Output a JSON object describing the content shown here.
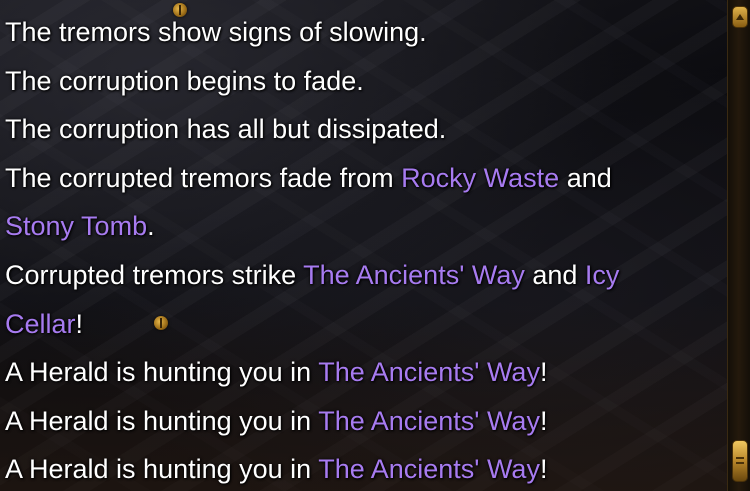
{
  "colors": {
    "text": "#ffffff",
    "location": "#a77bf0",
    "scroll_accent": "#c8962e"
  },
  "icons": {
    "map_marker": "gold-gem-marker-icon",
    "scroll_up": "scroll-up-arrow-icon",
    "scroll_thumb": "scroll-thumb-handle"
  },
  "log": {
    "lines": [
      {
        "text": "The tremors show signs of slowing."
      },
      {
        "text": "The corruption begins to fade."
      },
      {
        "text": "The corruption has all but dissipated."
      },
      {
        "pre": "The corrupted tremors fade from ",
        "loc1": "Rocky Waste",
        "mid": " and"
      },
      {
        "loc": "Stony Tomb",
        "post": "."
      },
      {
        "pre": "Corrupted tremors strike ",
        "loc1": "The Ancients' Way",
        "mid": " and ",
        "loc2": "Icy"
      },
      {
        "loc": "Cellar",
        "post": "!"
      },
      {
        "pre": "A Herald is hunting you in ",
        "loc": "The Ancients' Way",
        "post": "!"
      },
      {
        "pre": "A Herald is hunting you in ",
        "loc": "The Ancients' Way",
        "post": "!"
      },
      {
        "pre": "A Herald is hunting you in ",
        "loc": "The Ancients' Way",
        "post": "!"
      }
    ]
  }
}
